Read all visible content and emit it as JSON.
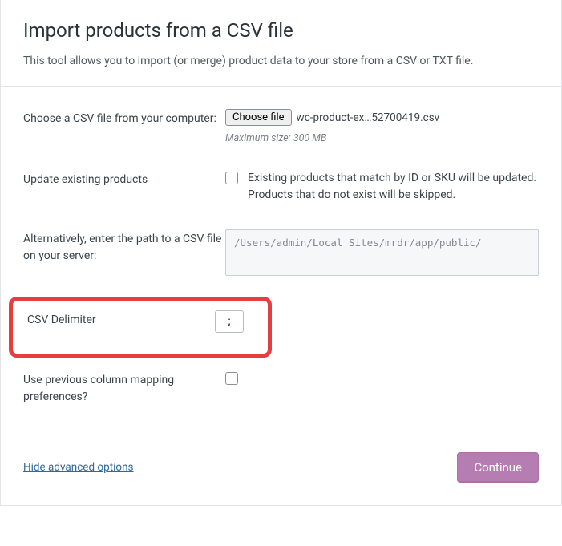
{
  "header": {
    "title": "Import products from a CSV file",
    "subtitle": "This tool allows you to import (or merge) product data to your store from a CSV or TXT file."
  },
  "fileRow": {
    "label": "Choose a CSV file from your computer:",
    "button": "Choose file",
    "filename": "wc-product-ex…52700419.csv",
    "maxsize": "Maximum size: 300 MB"
  },
  "updateRow": {
    "label": "Update existing products",
    "text": "Existing products that match by ID or SKU will be updated. Products that do not exist will be skipped."
  },
  "pathRow": {
    "label": "Alternatively, enter the path to a CSV file on your server:",
    "value": "/Users/admin/Local Sites/mrdr/app/public/"
  },
  "delimiterRow": {
    "label": "CSV Delimiter",
    "value": ";"
  },
  "mappingRow": {
    "label": "Use previous column mapping preferences?"
  },
  "footer": {
    "hide": "Hide advanced options",
    "continue": "Continue"
  }
}
